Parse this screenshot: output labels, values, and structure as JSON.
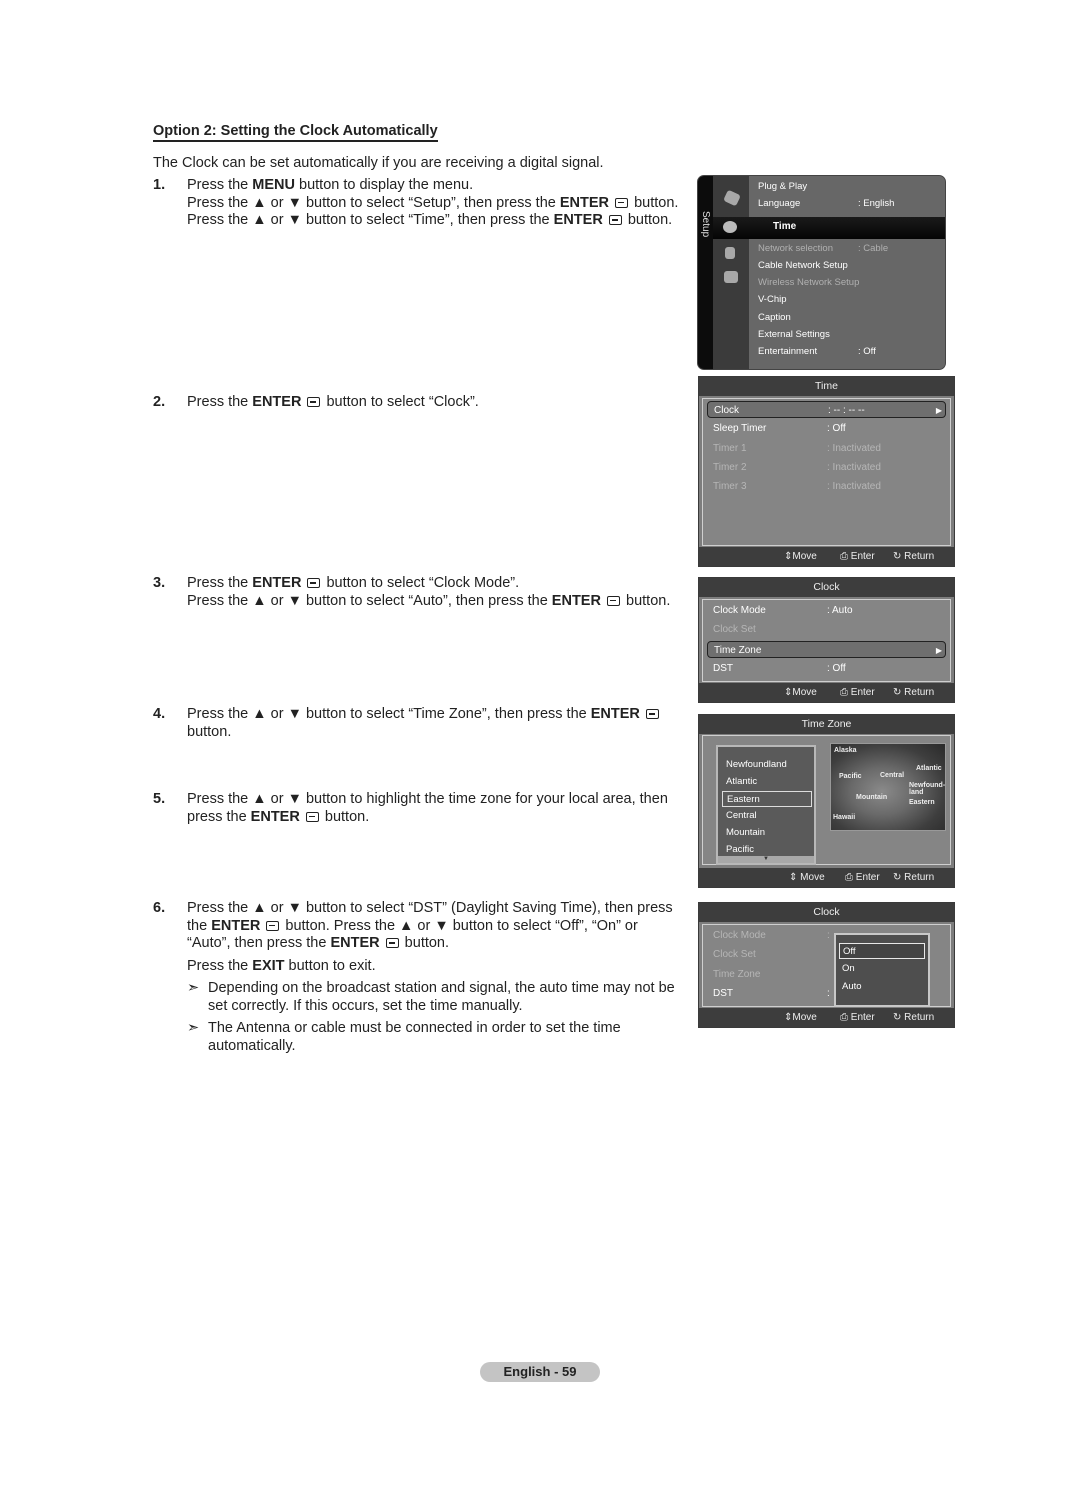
{
  "heading": "Option 2: Setting the Clock Automatically",
  "intro": "The Clock can be set automatically if you are receiving a digital signal.",
  "steps": [
    {
      "num": "1.",
      "lines": [
        [
          "Press the ",
          {
            "b": "MENU"
          },
          " button to display the menu."
        ],
        [
          "Press the ▲ or ▼ button to select “Setup”, then press the ",
          {
            "b": "ENTER"
          },
          {
            "icon": "enter"
          },
          " button."
        ],
        [
          "Press the ▲ or ▼ button to select “Time”, then press the ",
          {
            "b": "ENTER"
          },
          {
            "icon": "enter"
          },
          " button."
        ]
      ]
    },
    {
      "num": "2.",
      "lines": [
        [
          "Press the ",
          {
            "b": "ENTER"
          },
          {
            "icon": "enter"
          },
          " button to select “Clock”."
        ]
      ]
    },
    {
      "num": "3.",
      "lines": [
        [
          "Press the ",
          {
            "b": "ENTER"
          },
          {
            "icon": "enter"
          },
          " button to select “Clock Mode”."
        ],
        [
          "Press the ▲ or ▼ button to select “Auto”, then press the ",
          {
            "b": "ENTER"
          },
          {
            "icon": "enter"
          },
          " button."
        ]
      ]
    },
    {
      "num": "4.",
      "lines": [
        [
          "Press the ▲ or ▼ button to select “Time Zone”, then press the ",
          {
            "b": "ENTER"
          },
          {
            "icon": "enter"
          }
        ],
        [
          "button."
        ]
      ]
    },
    {
      "num": "5.",
      "lines": [
        [
          "Press the ▲ or ▼ button to highlight the time zone for your local area, then"
        ],
        [
          "press the ",
          {
            "b": "ENTER"
          },
          {
            "icon": "enter"
          },
          " button."
        ]
      ]
    },
    {
      "num": "6.",
      "lines": [
        [
          "Press the ▲ or ▼ button to select “DST” (Daylight Saving Time), then press"
        ],
        [
          "the ",
          {
            "b": "ENTER"
          },
          {
            "icon": "enter"
          },
          " button. Press the ▲ or ▼ button to select “Off”, “On” or"
        ],
        [
          "“Auto”, then press the ",
          {
            "b": "ENTER"
          },
          {
            "icon": "enter"
          },
          " button."
        ]
      ],
      "exit_line": [
        "Press the ",
        {
          "b": "EXIT"
        },
        " button to exit."
      ],
      "notes": [
        "Depending on the broadcast station and signal, the auto time may not be set correctly. If this occurs, set the time manually.",
        "The Antenna or cable must be connected in order to set the time automatically."
      ]
    }
  ],
  "note_arrow": "➣",
  "setup_menu": {
    "side_label": "Setup",
    "items": [
      {
        "label": "Plug & Play",
        "value": "",
        "dim": false
      },
      {
        "label": "Language",
        "value": ": English",
        "dim": false
      },
      {
        "label": "Time",
        "value": "",
        "selected": true
      },
      {
        "label": "Network selection",
        "value": ": Cable",
        "dim": true
      },
      {
        "label": "Cable Network Setup",
        "value": "",
        "dim": false
      },
      {
        "label": "Wireless Network Setup",
        "value": "",
        "dim": true
      },
      {
        "label": "V-Chip",
        "value": "",
        "dim": false
      },
      {
        "label": "Caption",
        "value": "",
        "dim": false
      },
      {
        "label": "External Settings",
        "value": "",
        "dim": false
      },
      {
        "label": "Entertainment",
        "value": ": Off",
        "dim": false
      }
    ]
  },
  "footer": {
    "move": "Move",
    "enter": "Enter",
    "return": "Return"
  },
  "time_panel": {
    "title": "Time",
    "rows": [
      {
        "label": "Clock",
        "value": ": -- : -- --",
        "selected": true,
        "dim": false
      },
      {
        "label": "Sleep Timer",
        "value": ": Off",
        "dim": false
      },
      {
        "label": "Timer 1",
        "value": ": Inactivated",
        "dim": true
      },
      {
        "label": "Timer 2",
        "value": ": Inactivated",
        "dim": true
      },
      {
        "label": "Timer 3",
        "value": ": Inactivated",
        "dim": true
      }
    ]
  },
  "clock_panel": {
    "title": "Clock",
    "rows": [
      {
        "label": "Clock Mode",
        "value": ": Auto",
        "dim": false
      },
      {
        "label": "Clock Set",
        "value": "",
        "dim": true
      },
      {
        "label": "Time Zone",
        "value": "",
        "selected": true,
        "dim": false
      },
      {
        "label": "DST",
        "value": ": Off",
        "dim": false
      }
    ]
  },
  "timezone_panel": {
    "title": "Time Zone",
    "zones": [
      "Newfoundland",
      "Atlantic",
      "Eastern",
      "Central",
      "Mountain",
      "Pacific"
    ],
    "selected": "Eastern",
    "map_labels": [
      "Alaska",
      "Pacific",
      "Central",
      "Atlantic",
      "Newfound-land",
      "Mountain",
      "Eastern",
      "Hawaii"
    ]
  },
  "dst_panel": {
    "title": "Clock",
    "rows": [
      {
        "label": "Clock Mode",
        "value": ":",
        "dim": true
      },
      {
        "label": "Clock Set",
        "value": "",
        "dim": true
      },
      {
        "label": "Time Zone",
        "value": "",
        "dim": true
      },
      {
        "label": "DST",
        "value": ":",
        "dim": false
      }
    ],
    "options": [
      "Off",
      "On",
      "Auto"
    ],
    "selected_option": "Off"
  },
  "page_label": "English - 59"
}
